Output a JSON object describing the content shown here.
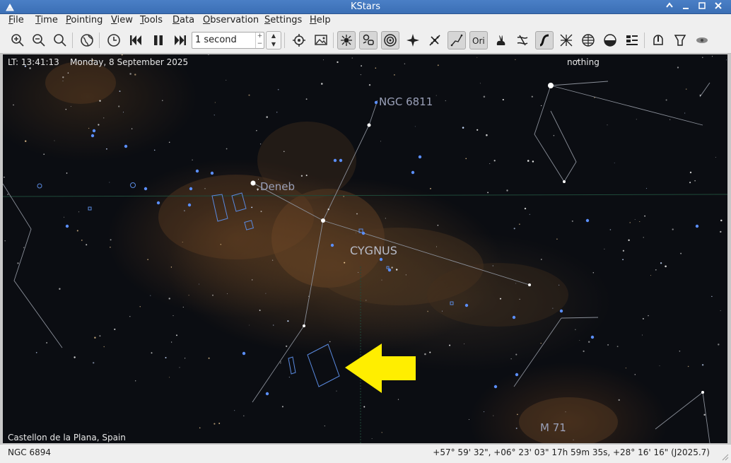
{
  "window": {
    "title": "KStars"
  },
  "menubar": {
    "items": [
      "File",
      "Time",
      "Pointing",
      "View",
      "Tools",
      "Data",
      "Observation",
      "Settings",
      "Help"
    ]
  },
  "toolbar": {
    "time_step_value": "1 second",
    "active_tools": [
      "show-stars",
      "show-deep-sky",
      "show-solar-system",
      "show-constellation-lines",
      "show-constellation-names",
      "show-milky-way"
    ]
  },
  "sky": {
    "local_time": "LT: 13:41:13",
    "date": "Monday, 8 September 2025",
    "focus_object": "nothing",
    "location": "Castellon de la Plana, Spain",
    "labels": {
      "ngc6811": "NGC 6811",
      "deneb": "Deneb",
      "cygnus": "CYGNUS",
      "m71": "M 71"
    },
    "highlight_color": "#ffee00",
    "star_color": "#5b8fff"
  },
  "statusbar": {
    "object": "NGC 6894",
    "coordinates": "+57° 59' 32\", +06° 23' 03\"  17h 59m 35s, +28° 16' 16\" (J2025.7)"
  }
}
